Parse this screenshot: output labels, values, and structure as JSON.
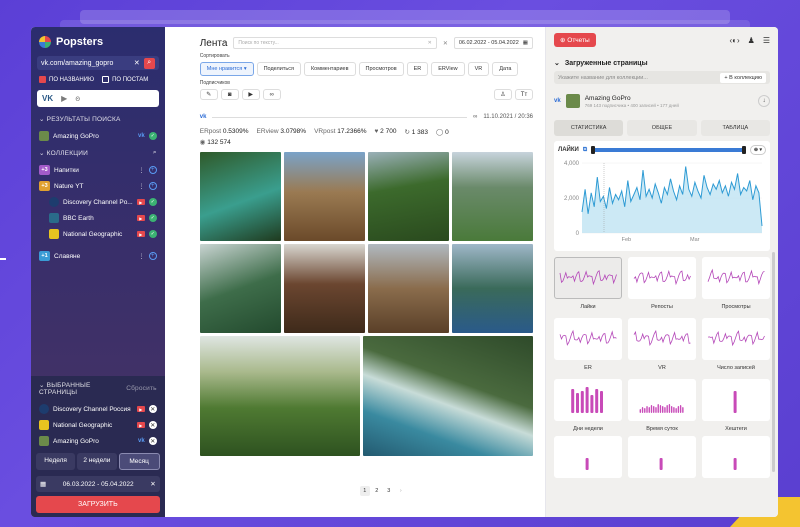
{
  "app": {
    "name": "Popsters"
  },
  "sidebar": {
    "search_value": "vk.com/amazing_gopro",
    "filters": [
      {
        "label": "ПО НАЗВАНИЮ",
        "checked": true
      },
      {
        "label": "ПО ПОСТАМ",
        "checked": false
      }
    ],
    "socials": [
      "VK",
      "YT",
      "OK"
    ],
    "results_header": "РЕЗУЛЬТАТЫ ПОИСКА",
    "results": [
      {
        "name": "Amazing GoPro"
      }
    ],
    "collections_header": "КОЛЛЕКЦИИ",
    "collections": [
      {
        "badge": "+3",
        "name": "Напитки"
      },
      {
        "badge": "+3",
        "name": "Nature YT"
      },
      {
        "name": "Discovery Channel Po..."
      },
      {
        "name": "BBC Earth"
      },
      {
        "name": "National Geographic"
      },
      {
        "badge": "+1",
        "name": "Славяне"
      }
    ],
    "selected_header": "ВЫБРАННЫЕ СТРАНИЦЫ",
    "reset_label": "Сбросить",
    "selected": [
      {
        "name": "Discovery Channel Россия"
      },
      {
        "name": "National Geographic"
      },
      {
        "name": "Amazing GoPro"
      }
    ],
    "periods": [
      "Неделя",
      "2 недели",
      "Месяц"
    ],
    "date_range": "06.03.2022 - 05.04.2022",
    "load_label": "ЗАГРУЗИТЬ"
  },
  "feed": {
    "title": "Лента",
    "search_placeholder": "Поиск по тексту...",
    "date_range": "06.02.2022 - 05.04.2022",
    "sort_label": "Сортировать",
    "sort_chips": [
      "Мне нравится",
      "Поделиться",
      "Комментариев",
      "Просмотров",
      "ER",
      "ERView",
      "VR",
      "Дата"
    ],
    "subs_label": "Подписчиков",
    "post": {
      "date": "11.10.2021 / 20:36",
      "erpost_label": "ERpost",
      "erpost": "0.5309%",
      "erview_label": "ERview",
      "erview": "3.0798%",
      "vrpost_label": "VRpost",
      "vrpost": "17.2366%",
      "likes": "2 700",
      "reposts": "1 383",
      "comments": "0",
      "views": "132 574"
    },
    "pages": [
      "1",
      "2",
      "3"
    ]
  },
  "analytics": {
    "reports_label": "Отчеты",
    "loaded_header": "Загруженные страницы",
    "collection_placeholder": "Укажите название для коллекции...",
    "add_collection": "+ В коллекцию",
    "page": {
      "name": "Amazing GoPro",
      "sub": "769 143 подписчика • 400 записей • 177 дней"
    },
    "tabs": [
      "СТАТИСТИКА",
      "ОБЩЕЕ",
      "ТАБЛИЦА"
    ],
    "chart_label": "ЛАЙКИ",
    "minis": [
      "Лайки",
      "Репосты",
      "Просмотры",
      "ER",
      "VR",
      "Число записей",
      "Дни недели",
      "Время суток",
      "Хештеги"
    ]
  },
  "chart_data": {
    "type": "area",
    "x_labels": [
      "Feb",
      "Mar"
    ],
    "y_ticks": [
      0,
      2000,
      4000
    ],
    "values": [
      1200,
      2500,
      1100,
      2300,
      1500,
      3200,
      1800,
      2100,
      1400,
      2600,
      1700,
      2200,
      1900,
      2400,
      1500,
      3000,
      1800,
      2200,
      2600,
      1900,
      3600,
      2100,
      2500,
      2000,
      2800,
      2300,
      1700,
      2600,
      2200,
      3100,
      2400,
      1900,
      2700,
      2200,
      3800,
      2500,
      2100,
      2900,
      2400,
      2000,
      3300,
      2600,
      2200,
      2800,
      2500,
      3000,
      2300,
      2700,
      2100,
      2900,
      2500,
      3400,
      2200,
      2600,
      2400,
      3000,
      1900,
      2700,
      2300,
      400
    ],
    "ylim": [
      0,
      4000
    ]
  }
}
